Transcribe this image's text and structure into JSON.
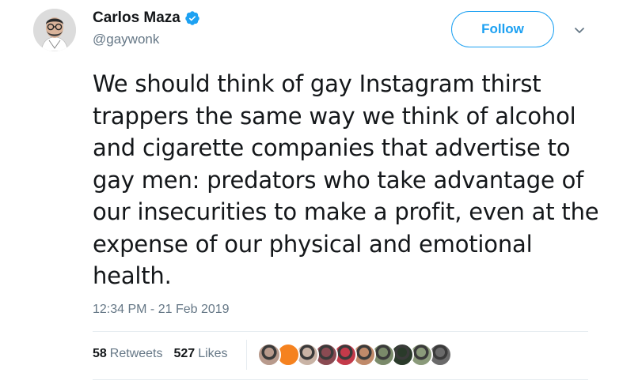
{
  "author": {
    "display_name": "Carlos Maza",
    "handle": "@gaywonk",
    "verified": true,
    "avatar_icon": "profile-photo"
  },
  "header": {
    "follow_label": "Follow",
    "more_icon": "chevron-down-icon"
  },
  "tweet": {
    "text": "We should think of gay Instagram thirst trappers the same way we think of alcohol and cigarette companies that advertise to gay men: predators who take advantage of our insecurities to make a profit, even at the expense of our physical and emotional health.",
    "timestamp": "12:34 PM - 21 Feb 2019"
  },
  "stats": {
    "retweets_count": "58",
    "retweets_label": "Retweets",
    "likes_count": "527",
    "likes_label": "Likes"
  },
  "likers": [
    {
      "color": "#b89a8c"
    },
    {
      "color": "#f5821f"
    },
    {
      "color": "#c9b3a5"
    },
    {
      "color": "#8a4a52"
    },
    {
      "color": "#c43a4a"
    },
    {
      "color": "#c08a6a"
    },
    {
      "color": "#7a8a6a"
    },
    {
      "color": "#2a3a2a"
    },
    {
      "color": "#8a9a7a"
    },
    {
      "color": "#6a6a6a"
    }
  ],
  "colors": {
    "accent": "#1da1f2",
    "muted": "#657786",
    "text": "#14171a"
  }
}
